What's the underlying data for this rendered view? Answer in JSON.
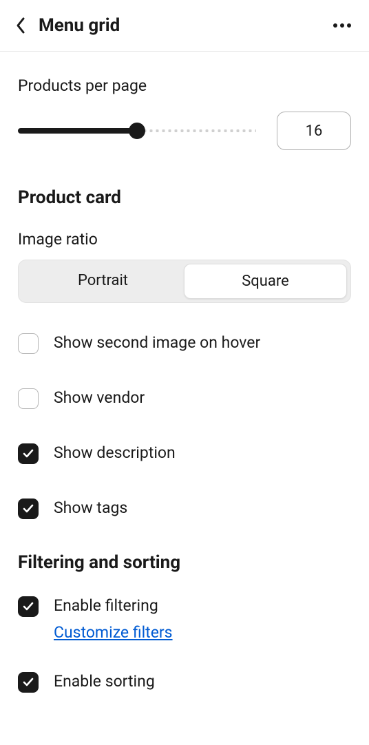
{
  "header": {
    "title": "Menu grid"
  },
  "products_per_page": {
    "label": "Products per page",
    "value": "16",
    "slider_percent": 50
  },
  "product_card": {
    "heading": "Product card",
    "image_ratio": {
      "label": "Image ratio",
      "options": [
        "Portrait",
        "Square"
      ],
      "selected": "Square"
    },
    "checks": {
      "second_image": {
        "label": "Show second image on hover",
        "checked": false
      },
      "vendor": {
        "label": "Show vendor",
        "checked": false
      },
      "description": {
        "label": "Show description",
        "checked": true
      },
      "tags": {
        "label": "Show tags",
        "checked": true
      }
    }
  },
  "filtering": {
    "heading": "Filtering and sorting",
    "enable_filtering": {
      "label": "Enable filtering",
      "checked": true,
      "link": "Customize filters"
    },
    "enable_sorting": {
      "label": "Enable sorting",
      "checked": true
    }
  }
}
